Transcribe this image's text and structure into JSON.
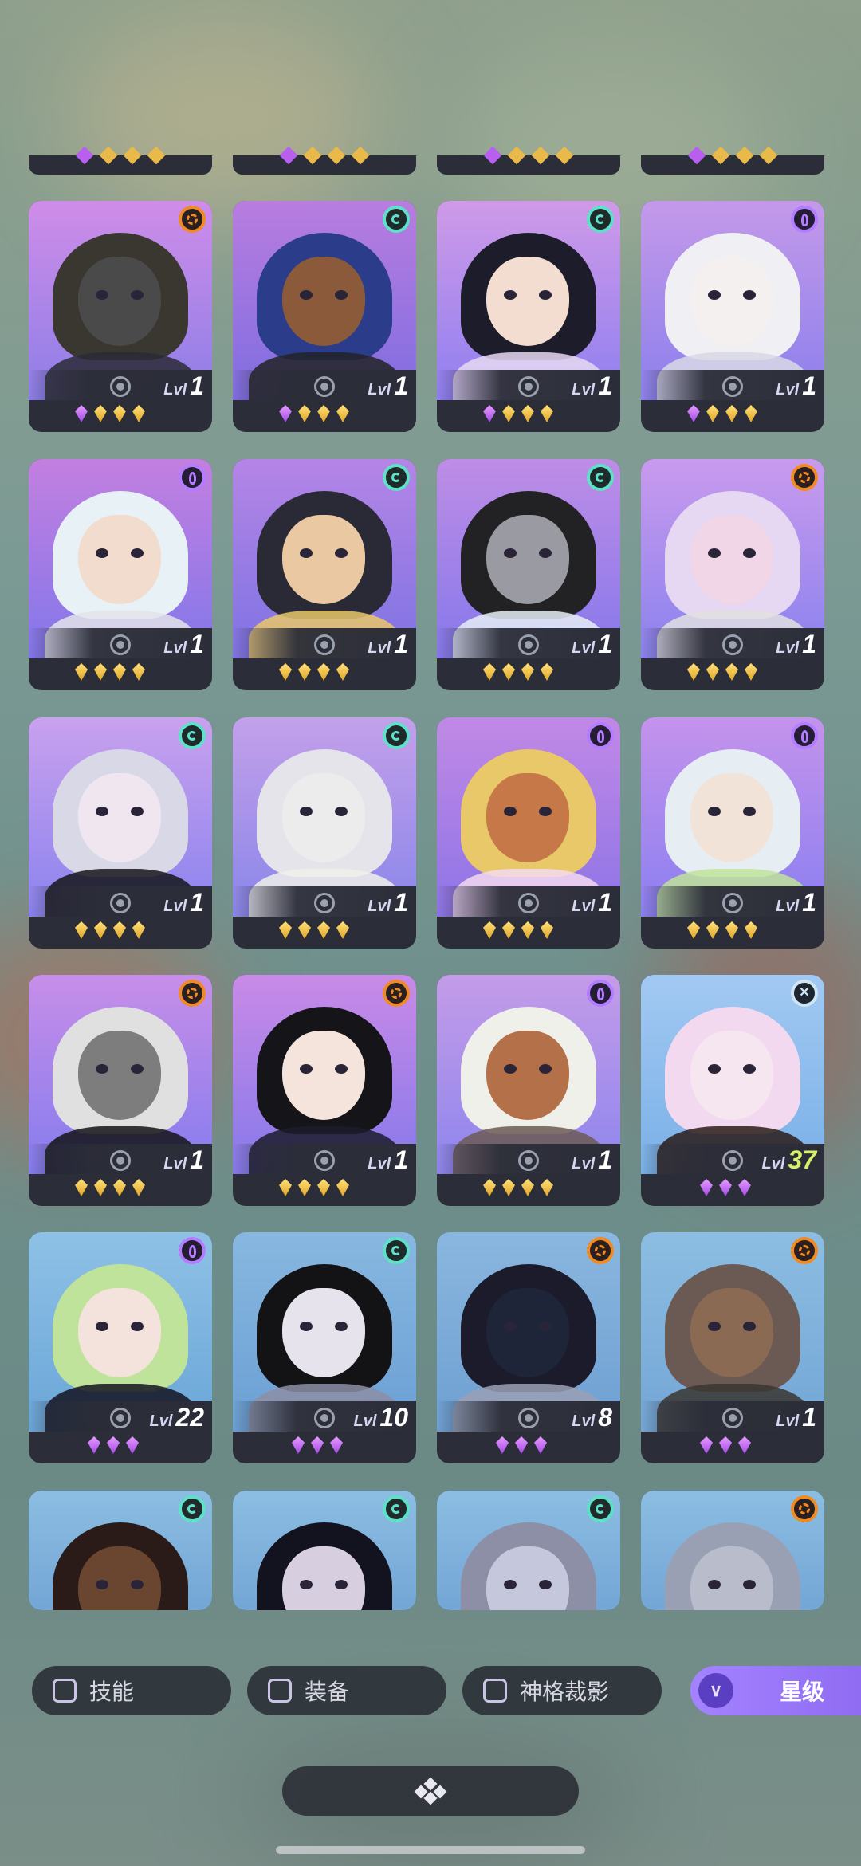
{
  "roster": {
    "top_partial_row": {
      "gem_color": "#e9b949"
    },
    "cards": [
      {
        "level_label": "Lvl",
        "level": "1",
        "badge": "orange-faction-icon",
        "gems": [
          "purple",
          "gold",
          "gold",
          "gold"
        ]
      },
      {
        "level_label": "Lvl",
        "level": "1",
        "badge": "teal-faction-icon",
        "gems": [
          "purple",
          "gold",
          "gold",
          "gold"
        ]
      },
      {
        "level_label": "Lvl",
        "level": "1",
        "badge": "teal-faction-icon",
        "gems": [
          "purple",
          "gold",
          "gold",
          "gold"
        ]
      },
      {
        "level_label": "Lvl",
        "level": "1",
        "badge": "violet-faction-icon",
        "gems": [
          "purple",
          "gold",
          "gold",
          "gold"
        ]
      },
      {
        "level_label": "Lvl",
        "level": "1",
        "badge": "violet-faction-icon",
        "gems": [
          "gold",
          "gold",
          "gold",
          "gold"
        ]
      },
      {
        "level_label": "Lvl",
        "level": "1",
        "badge": "teal-faction-icon",
        "gems": [
          "gold",
          "gold",
          "gold",
          "gold"
        ]
      },
      {
        "level_label": "Lvl",
        "level": "1",
        "badge": "teal-faction-icon",
        "gems": [
          "gold",
          "gold",
          "gold",
          "gold"
        ]
      },
      {
        "level_label": "Lvl",
        "level": "1",
        "badge": "orange-faction-icon",
        "gems": [
          "gold",
          "gold",
          "gold",
          "gold"
        ]
      },
      {
        "level_label": "Lvl",
        "level": "1",
        "badge": "teal-faction-icon",
        "gems": [
          "gold",
          "gold",
          "gold",
          "gold"
        ]
      },
      {
        "level_label": "Lvl",
        "level": "1",
        "badge": "teal-faction-icon",
        "gems": [
          "gold",
          "gold",
          "gold",
          "gold"
        ]
      },
      {
        "level_label": "Lvl",
        "level": "1",
        "badge": "violet-faction-icon",
        "gems": [
          "gold",
          "gold",
          "gold",
          "gold"
        ]
      },
      {
        "level_label": "Lvl",
        "level": "1",
        "badge": "violet-faction-icon",
        "gems": [
          "gold",
          "gold",
          "gold",
          "gold"
        ]
      },
      {
        "level_label": "Lvl",
        "level": "1",
        "badge": "orange-faction-icon",
        "gems": [
          "gold",
          "gold",
          "gold",
          "gold"
        ]
      },
      {
        "level_label": "Lvl",
        "level": "1",
        "badge": "orange-faction-icon",
        "gems": [
          "gold",
          "gold",
          "gold",
          "gold"
        ]
      },
      {
        "level_label": "Lvl",
        "level": "1",
        "badge": "violet-faction-icon",
        "gems": [
          "gold",
          "gold",
          "gold",
          "gold"
        ]
      },
      {
        "level_label": "Lvl",
        "level": "37",
        "badge": "silver-faction-icon",
        "gems": [
          "purple",
          "purple",
          "purple"
        ]
      },
      {
        "level_label": "Lvl",
        "level": "22",
        "badge": "violet-faction-icon",
        "gems": [
          "purple",
          "purple",
          "purple"
        ]
      },
      {
        "level_label": "Lvl",
        "level": "10",
        "badge": "teal-faction-icon",
        "gems": [
          "purple",
          "purple",
          "purple"
        ]
      },
      {
        "level_label": "Lvl",
        "level": "8",
        "badge": "orange-faction-icon",
        "gems": [
          "purple",
          "purple",
          "purple"
        ]
      },
      {
        "level_label": "Lvl",
        "level": "1",
        "badge": "orange-faction-icon",
        "gems": [
          "purple",
          "purple",
          "purple"
        ]
      },
      {
        "level_label": "",
        "level": "",
        "badge": "teal-faction-icon",
        "gems": []
      },
      {
        "level_label": "",
        "level": "",
        "badge": "teal-faction-icon",
        "gems": []
      },
      {
        "level_label": "",
        "level": "",
        "badge": "teal-faction-icon",
        "gems": []
      },
      {
        "level_label": "",
        "level": "",
        "badge": "orange-faction-icon",
        "gems": []
      }
    ]
  },
  "filters": {
    "skill_label": "技能",
    "equipment_label": "装备",
    "divine_label": "神格裁影",
    "star_label": "星级"
  },
  "colors": {
    "card_bg": "#2b2d38",
    "accent_purple": "#9b79fb",
    "gem_gold": "#e9b949",
    "gem_purple": "#b85ff0",
    "level_highlight": "#d9f06a"
  }
}
